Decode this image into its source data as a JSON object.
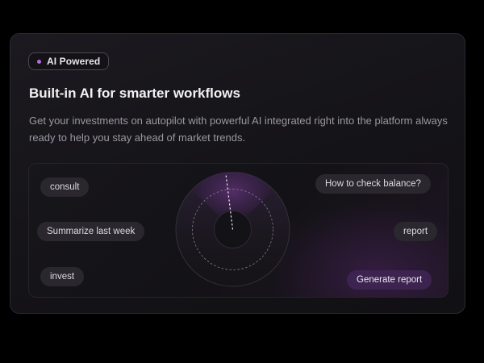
{
  "badge": {
    "label": "AI Powered",
    "dot_color": "#b46ce0"
  },
  "heading": "Built-in AI for smarter workflows",
  "description": "Get your investments on autopilot with powerful AI integrated right into the platform always ready to help you stay ahead of market trends.",
  "chips": {
    "consult": "consult",
    "summarize": "Summarize last week",
    "invest": "invest",
    "check_balance": "How to check balance?",
    "report": "report",
    "generate_report": "Generate report"
  },
  "colors": {
    "accent": "#b46ce0",
    "accent_chip_bg": "#3c2350",
    "chip_bg": "#2a282e",
    "background": "#000000"
  },
  "icons": {
    "radar": "radar-icon",
    "badge_dot": "dot-icon"
  }
}
